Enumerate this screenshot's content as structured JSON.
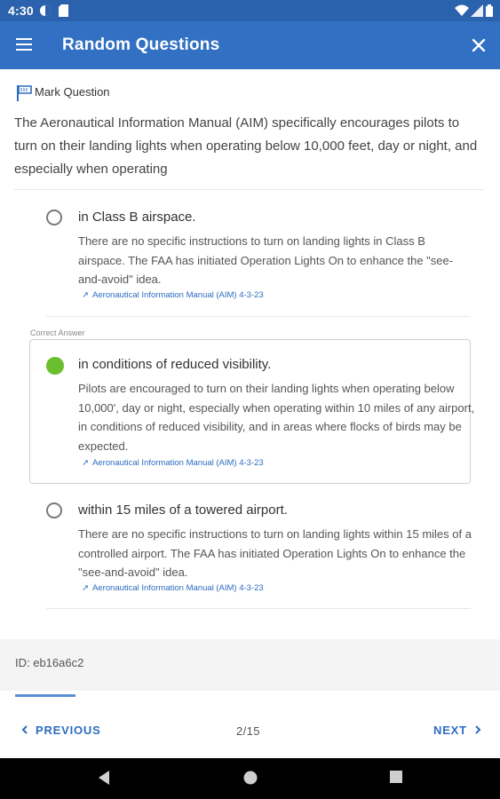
{
  "status_bar": {
    "time": "4:30"
  },
  "app_bar": {
    "title": "Random Questions"
  },
  "mark_question": {
    "label": "Mark Question"
  },
  "question": {
    "text": "The Aeronautical Information Manual (AIM) specifically encourages pilots to turn on their landing lights when operating below 10,000 feet, day or night, and especially when operating"
  },
  "correct_answer_label": "Correct Answer",
  "answers": [
    {
      "text": "in Class B airspace.",
      "explanation": "There are no specific instructions to turn on landing lights in Class B airspace. The FAA has initiated Operation Lights On to enhance the \"see-and-avoid\" idea.",
      "reference": "Aeronautical Information Manual (AIM) 4-3-23",
      "correct": false
    },
    {
      "text": "in conditions of reduced visibility.",
      "explanation": "Pilots are encouraged to turn on their landing lights when operating below 10,000', day or night, especially when operating within 10 miles of any airport, in conditions of reduced visibility, and in areas where flocks of birds may be expected.",
      "reference": "Aeronautical Information Manual (AIM) 4-3-23",
      "correct": true
    },
    {
      "text": "within 15 miles of a towered airport.",
      "explanation": "There are no specific instructions to turn on landing lights within 15 miles of a controlled airport. The FAA has initiated Operation Lights On to enhance the \"see-and-avoid\" idea.",
      "reference": "Aeronautical Information Manual (AIM) 4-3-23",
      "correct": false
    }
  ],
  "footer": {
    "id_text": "ID: eb16a6c2",
    "progress_fraction": 0.13,
    "previous_label": "PREVIOUS",
    "next_label": "NEXT",
    "page_indicator": "2/15"
  },
  "colors": {
    "status_bar": "#2a62ad",
    "app_bar": "#3170c2",
    "accent": "#2d6cc0",
    "correct": "#6bbf2f"
  },
  "icons": {
    "menu": "menu-icon",
    "close": "close-icon",
    "flag": "flag-icon",
    "link": "external-link-icon",
    "prev": "chevron-left-icon",
    "next": "chevron-right-icon"
  }
}
